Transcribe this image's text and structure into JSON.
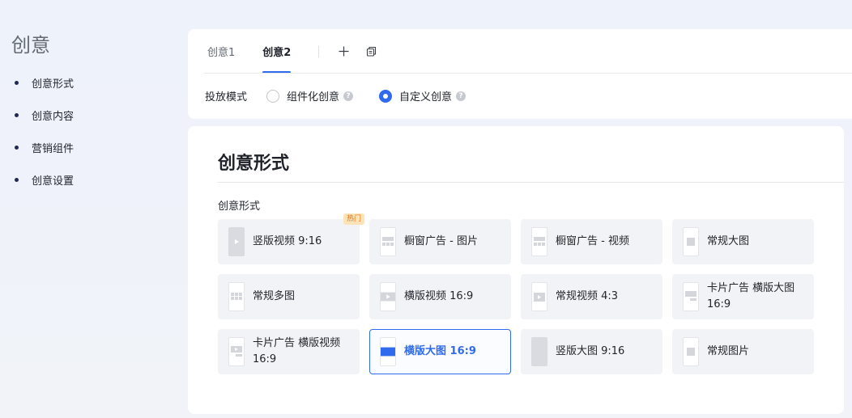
{
  "sidebar": {
    "title": "创意",
    "items": [
      {
        "label": "创意形式"
      },
      {
        "label": "创意内容"
      },
      {
        "label": "营销组件"
      },
      {
        "label": "创意设置"
      }
    ]
  },
  "tabs": [
    {
      "label": "创意1",
      "active": false
    },
    {
      "label": "创意2",
      "active": true
    }
  ],
  "tab_actions": {
    "add_icon": "plus-icon",
    "copy_icon": "copy-icon"
  },
  "delivery_mode": {
    "label": "投放模式",
    "options": [
      {
        "label": "组件化创意",
        "checked": false
      },
      {
        "label": "自定义创意",
        "checked": true
      }
    ],
    "help_icon": "question-circle-icon"
  },
  "section": {
    "title": "创意形式",
    "field_label": "创意形式"
  },
  "formats": [
    {
      "label": "竖版视频 9:16",
      "badge": "热门",
      "thumb": "vertical-video"
    },
    {
      "label": "橱窗广告 - 图片",
      "thumb": "showcase"
    },
    {
      "label": "橱窗广告 - 视频",
      "thumb": "showcase"
    },
    {
      "label": "常规大图",
      "thumb": "square"
    },
    {
      "label": "常规多图",
      "thumb": "multi"
    },
    {
      "label": "横版视频 16:9",
      "thumb": "horizontal-video"
    },
    {
      "label": "常规视频  4:3",
      "thumb": "video-4-3"
    },
    {
      "label": "卡片广告 横版大图 16:9",
      "thumb": "card-image"
    },
    {
      "label": "卡片广告 横版视频 16:9",
      "thumb": "card-video"
    },
    {
      "label": "横版大图 16:9",
      "thumb": "horizontal-image",
      "selected": true
    },
    {
      "label": "竖版大图 9:16",
      "thumb": "vertical-image"
    },
    {
      "label": "常规图片",
      "thumb": "square"
    }
  ],
  "colors": {
    "accent": "#2f6bec",
    "hot_badge_bg": "#fde4b8",
    "hot_badge_text": "#e37318"
  }
}
